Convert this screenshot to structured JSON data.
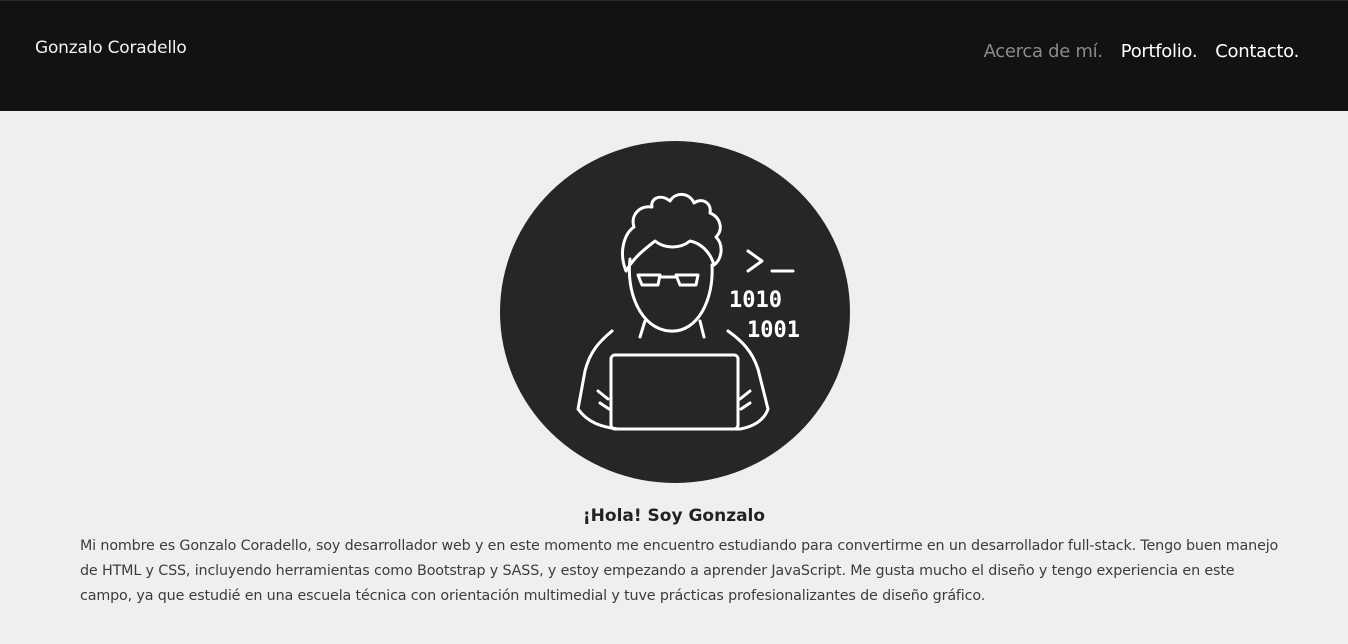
{
  "header": {
    "brand": "Gonzalo Coradello",
    "nav": [
      {
        "label": "Acerca de mí."
      },
      {
        "label": "Portfolio."
      },
      {
        "label": "Contacto."
      }
    ]
  },
  "hero": {
    "illustration": {
      "prompt_text": ">_",
      "binary_line_1": "1010",
      "binary_line_2": "1001"
    },
    "greeting": "¡Hola! Soy Gonzalo",
    "bio": "Mi nombre es Gonzalo Coradello, soy desarrollador web y en este momento me encuentro estudiando para convertirme en un desarrollador full-stack. Tengo buen manejo de HTML y CSS, incluyendo herramientas como Bootstrap y SASS, y estoy empezando a aprender JavaScript. Me gusta mucho el diseño y tengo experiencia en este campo, ya que estudié en una escuela técnica con orientación multimedial y tuve prácticas profesionalizantes de diseño gráfico."
  },
  "colors": {
    "navbar_bg": "#121212",
    "page_bg": "#efefef",
    "avatar_bg": "#262626",
    "active_link": "#8a8a8a"
  }
}
